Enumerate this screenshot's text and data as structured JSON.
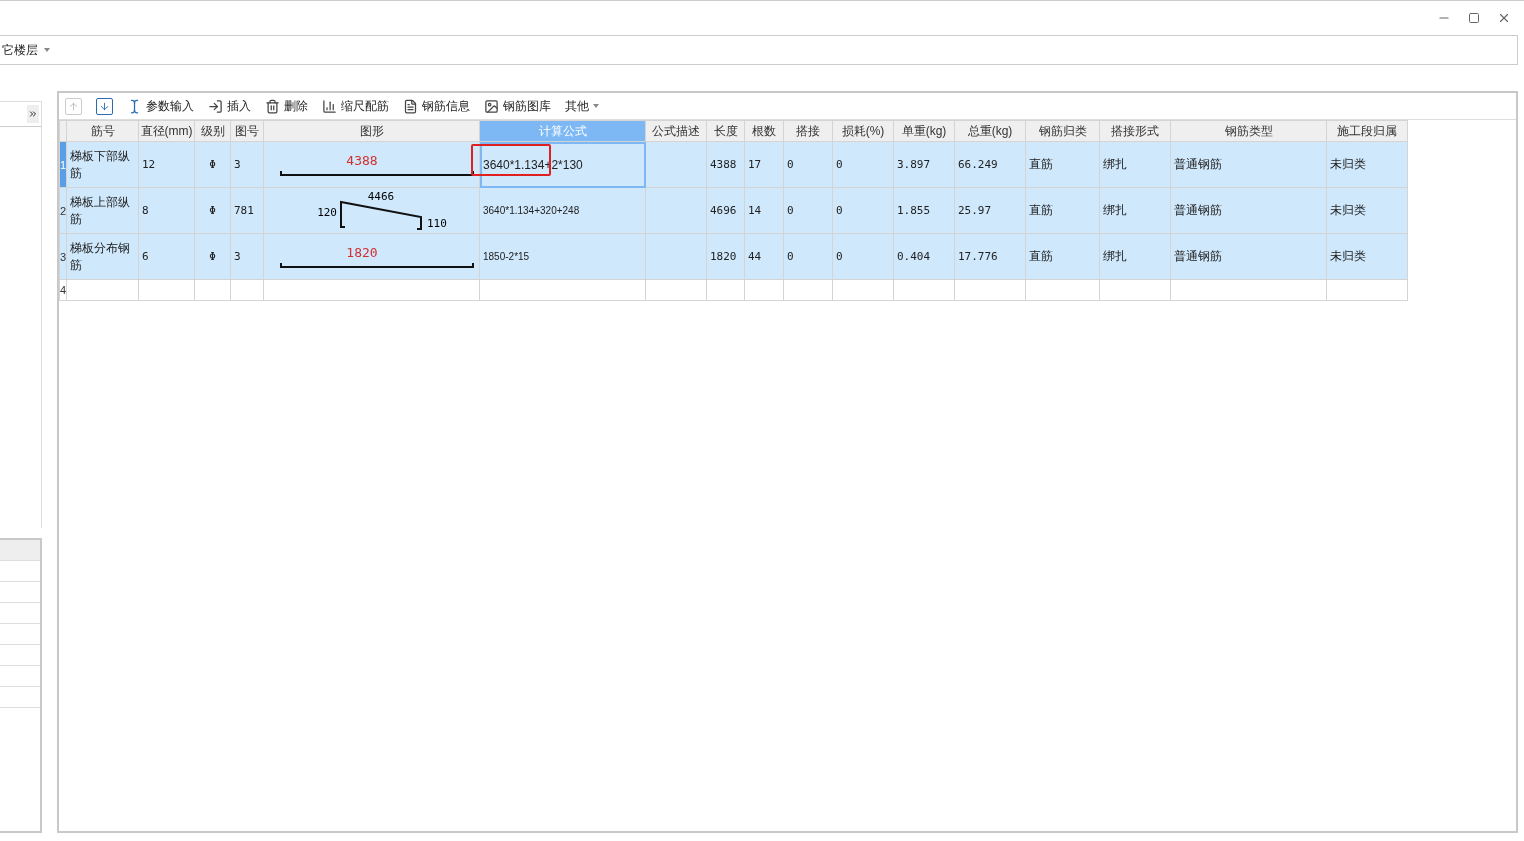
{
  "floor_selector": {
    "label": "它楼层"
  },
  "toolbar": [
    {
      "kind": "up",
      "disabled": true
    },
    {
      "kind": "down",
      "disabled": false
    },
    {
      "kind": "params",
      "label": "参数输入",
      "disabled": false
    },
    {
      "kind": "insert",
      "label": "插入",
      "disabled": false
    },
    {
      "kind": "delete",
      "label": "删除",
      "disabled": false
    },
    {
      "kind": "scale",
      "label": "缩尺配筋",
      "disabled": false
    },
    {
      "kind": "info",
      "label": "钢筋信息",
      "disabled": false
    },
    {
      "kind": "library",
      "label": "钢筋图库",
      "disabled": false
    },
    {
      "kind": "menu",
      "label": "其他",
      "disabled": false
    }
  ],
  "table": {
    "columns": [
      {
        "label": "筋号",
        "selected": false
      },
      {
        "label": "直径(mm)",
        "selected": false
      },
      {
        "label": "级别",
        "selected": false
      },
      {
        "label": "图号",
        "selected": false
      },
      {
        "label": "图形",
        "selected": false
      },
      {
        "label": "计算公式",
        "selected": true
      },
      {
        "label": "公式描述",
        "selected": false
      },
      {
        "label": "长度",
        "selected": false
      },
      {
        "label": "根数",
        "selected": false
      },
      {
        "label": "搭接",
        "selected": false
      },
      {
        "label": "损耗(%)",
        "selected": false
      },
      {
        "label": "单重(kg)",
        "selected": false
      },
      {
        "label": "总重(kg)",
        "selected": false
      },
      {
        "label": "钢筋归类",
        "selected": false
      },
      {
        "label": "搭接形式",
        "selected": false
      },
      {
        "label": "钢筋类型",
        "selected": false
      },
      {
        "label": "施工段归属",
        "selected": false
      }
    ],
    "rows": [
      {
        "number": "1",
        "selected": true,
        "annotated": true,
        "name": "梯板下部纵筋",
        "diameter": "12",
        "grade": "Φ",
        "shape_no": "3",
        "shape": {
          "kind": "straight",
          "labels": [
            "4388"
          ]
        },
        "formula": "3640*1.134+2*130",
        "length": "4388",
        "count": "17",
        "lap": "0",
        "loss": "0",
        "unit_weight": "3.897",
        "total_weight": "66.249",
        "category": "直筋",
        "lap_form": "绑扎",
        "type": "普通钢筋",
        "stage": "未归类"
      },
      {
        "number": "2",
        "selected": false,
        "annotated": false,
        "name": "梯板上部纵筋",
        "diameter": "8",
        "grade": "Φ",
        "shape_no": "781",
        "shape": {
          "kind": "bent",
          "labels": [
            "120",
            "4466",
            "110"
          ]
        },
        "formula": "3640*1.134+320+248",
        "length": "4696",
        "count": "14",
        "lap": "0",
        "loss": "0",
        "unit_weight": "1.855",
        "total_weight": "25.97",
        "category": "直筋",
        "lap_form": "绑扎",
        "type": "普通钢筋",
        "stage": "未归类"
      },
      {
        "number": "3",
        "selected": false,
        "annotated": false,
        "name": "梯板分布钢筋",
        "diameter": "6",
        "grade": "Φ",
        "shape_no": "3",
        "shape": {
          "kind": "straight",
          "labels": [
            "1820"
          ]
        },
        "formula": "1850-2*15",
        "length": "1820",
        "count": "44",
        "lap": "0",
        "loss": "0",
        "unit_weight": "0.404",
        "total_weight": "17.776",
        "category": "直筋",
        "lap_form": "绑扎",
        "type": "普通钢筋",
        "stage": "未归类"
      }
    ],
    "blank_row": {
      "number": "4"
    }
  }
}
